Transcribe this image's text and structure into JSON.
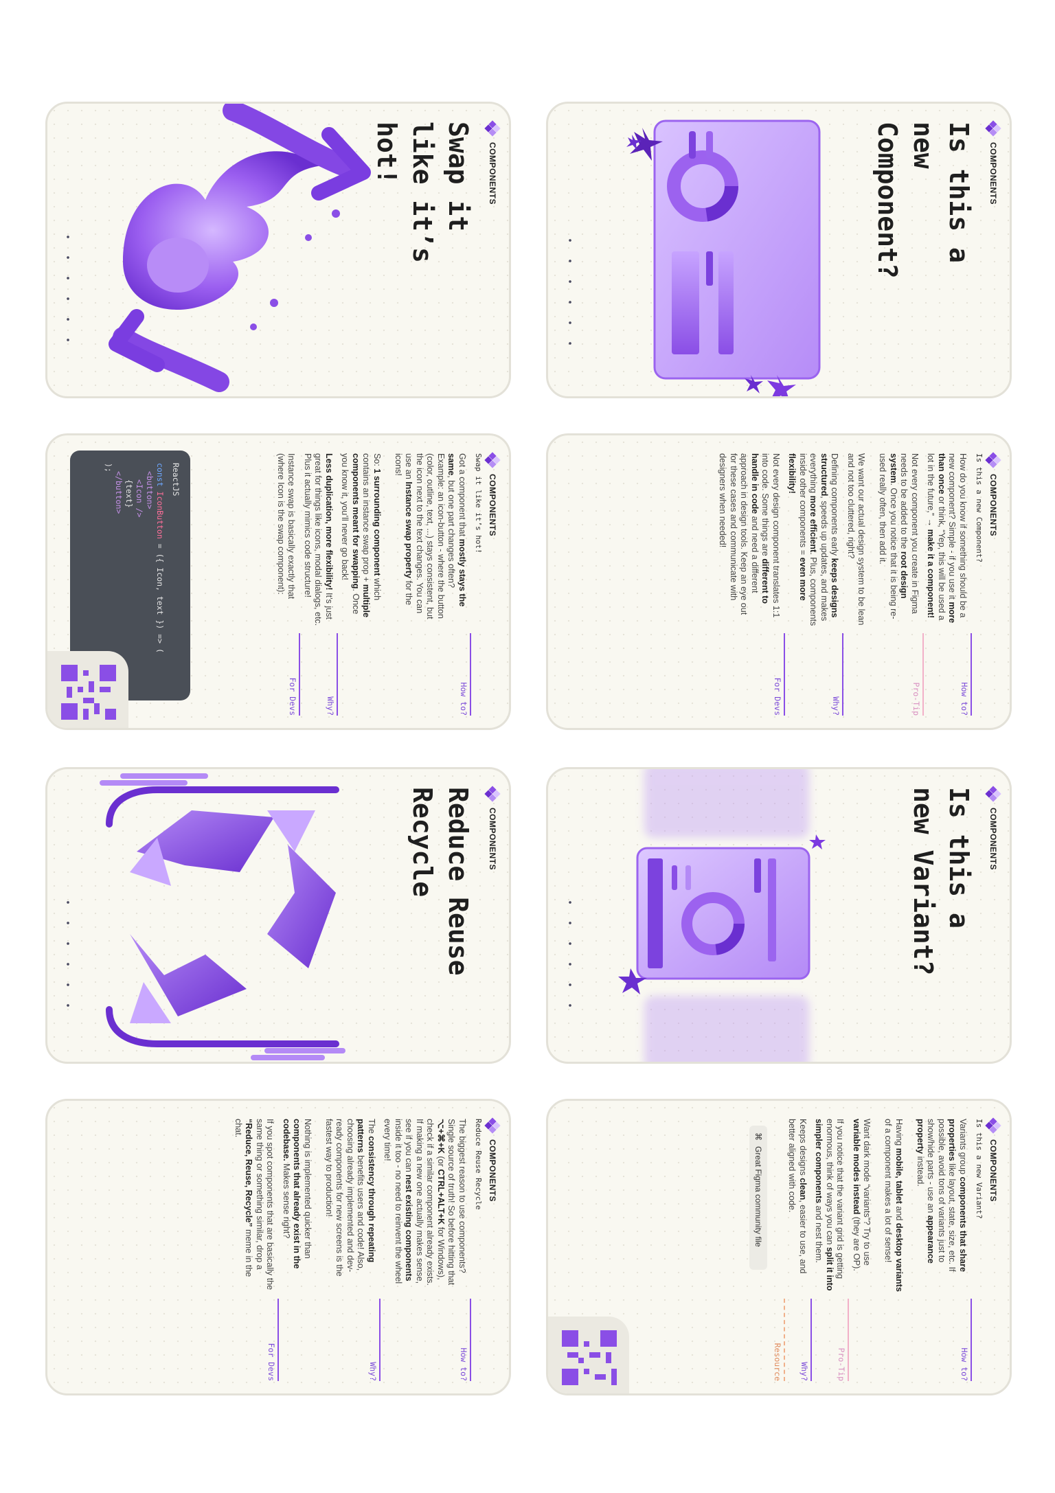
{
  "brand": "COMPONENTS",
  "cards": {
    "c1": {
      "title": "Is this a new Component?"
    },
    "c2": {
      "title": "Swap it like it’s hot!"
    },
    "c3": {
      "subtitle": "Is this a new Component?",
      "howto_label": "How to?",
      "howto_html": "How do you know if something should be a new component? Simple - if you use it <b>more than once</b> or think, “Yep, this will be used a lot in the future,” <b>→ make it a component!</b>",
      "protip_label": "Pro-Tip",
      "protip_html": "Not every component you create in Figma needs to be added to the <b>root design system</b>. Once you notice that it is being re-used really often, then add it.<br><br>We want our actual design system to be lean and not too cluttered, right?",
      "why_label": "Why?",
      "why_html": "Defining components early <b>keeps designs structured</b>, speeds up updates, and makes everything <b>more efficient</b>. Plus, components inside other components = <b>even more flexibility!</b>",
      "devs_label": "For Devs",
      "devs_html": "Not every design component translates 1:1 into code. Some things are <b>different to handle in code</b> and need a different approach in design tools. Keep an eye out for these cases and communicate with designers when needed!"
    },
    "c4": {
      "subtitle": "Swap it like it’s hot!",
      "howto_label": "How to?",
      "howto_html": "Got a component that <b>mostly stays the same</b>, but one part changes often? Example: an icon-button - where the button (color, outline, text, ...) stays consistent, but the icon next to the text changes. You can use an <b>Instance swap property</b> for the icons!<br><br>So: <b>1 surrounding component</b> which contains an instance swap prop + <b>multiple components meant for swapping</b>. Once you know it, you’ll never go back!",
      "why_label": "Why?",
      "why_html": "<b>Less duplication, more flexibility!</b> It’s just great for things like icons, modal dialogs, etc. Plus it actually mimics code structure!",
      "devs_label": "For Devs",
      "devs_html": "Instance swap is basically exactly that (where Icon is the swap component):",
      "code_title": "ReactJS",
      "code_l1a": "const ",
      "code_l1b": "IconButton",
      "code_l1c": " = ({ Icon, text }) => (",
      "code_l2": "<button>",
      "code_l3": "<Icon />",
      "code_l4": "{text}",
      "code_l5": "</button>",
      "code_l6": ");"
    },
    "c5": {
      "title": "Is this a new Variant?"
    },
    "c6": {
      "title": "Reduce Reuse Recycle"
    },
    "c7": {
      "subtitle": "Is this a new Variant?",
      "howto_label": "How to?",
      "howto_html": "Variants group <b>components that share properties</b> like layout, state, size, etc. If possible, avoid tons of variants just to show/hide parts - use an <b>appearance property</b> instead.<br><br>Having <b>mobile, tablet</b> and <b>desktop variants</b> of a component makes a lot of sense!<br><br>Want dark mode “variants”? Try to use <b>variable modes instead</b> (they are OP).",
      "protip_label": "Pro-Tip",
      "protip_html": "If you notice that the variant grid is getting enormous, think of ways you can <b>split it into simpler components</b> and nest them.",
      "why_label": "Why?",
      "why_html": "Keeps designs <b>clean</b>, easier to use, and better aligned with code.",
      "res_label": "Resource",
      "res_text": "Great Figma community file"
    },
    "c8": {
      "subtitle": "Reduce Reuse Recycle",
      "howto_label": "How to?",
      "howto_html": "The biggest reason to use components? Single source of truth! So before hitting that <b>⌥+⌘+K</b> (or <b>CTRL+ALT+K</b> for Windows), check if a similar component already exists. If making a new one actually makes sense, see if you can <b>nest existing components</b> inside it too - no need to reinvent the wheel every time!",
      "why_label": "Why?",
      "why_html": "The <b>consistency through repeating patterns</b> benefits users and code! Also, choosing already implemented and dev-ready components for new screens is the fastest way to production!<br><br>Nothing is implemented quicker than <b>components that already exist in the codebase.</b> Makes sense right?",
      "devs_label": "For Devs",
      "devs_html": "If you spot components that are basically the same thing or something similar, drop a <b>“Reduce, Reuse, Recycle”</b> meme in the chat."
    }
  },
  "colors": {
    "accent": "#8a4ee6",
    "accent_light": "#c9a8ff",
    "card_bg": "#f9f8f1"
  }
}
